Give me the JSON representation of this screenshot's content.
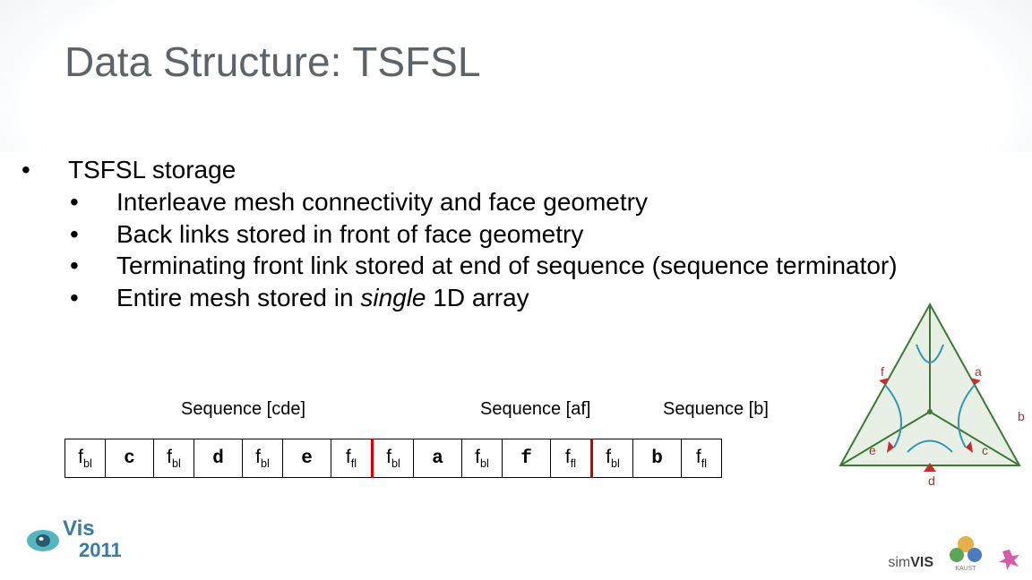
{
  "title": "Data Structure: TSFSL",
  "bullets": {
    "l1": "TSFSL storage",
    "l2": [
      "Interleave mesh connectivity and face geometry",
      "Back links stored in front of face geometry",
      "Terminating front link stored at end of sequence (sequence terminator)",
      "Entire mesh stored in single 1D array"
    ],
    "italic_word": "single"
  },
  "sequence_labels": {
    "cde": "Sequence [cde]",
    "af": "Sequence [af]",
    "b": "Sequence [b]"
  },
  "sequence_cells": [
    {
      "t": "fbl",
      "type": "fbl"
    },
    {
      "t": "c",
      "type": "face"
    },
    {
      "t": "fbl",
      "type": "fbl"
    },
    {
      "t": "d",
      "type": "face"
    },
    {
      "t": "fbl",
      "type": "fbl"
    },
    {
      "t": "e",
      "type": "face"
    },
    {
      "t": "ffl",
      "type": "ffl",
      "sep": true
    },
    {
      "t": "fbl",
      "type": "fbl"
    },
    {
      "t": "a",
      "type": "face"
    },
    {
      "t": "fbl",
      "type": "fbl"
    },
    {
      "t": "f",
      "type": "face"
    },
    {
      "t": "ffl",
      "type": "ffl",
      "sep": true
    },
    {
      "t": "fbl",
      "type": "fbl"
    },
    {
      "t": "b",
      "type": "face"
    },
    {
      "t": "ffl",
      "type": "ffl"
    }
  ],
  "triangle_labels": [
    "a",
    "b",
    "c",
    "d",
    "e",
    "f"
  ],
  "footer": {
    "vis": "Vis",
    "year": "2011",
    "simvis": "simVIS",
    "kaust": "KAUST"
  }
}
